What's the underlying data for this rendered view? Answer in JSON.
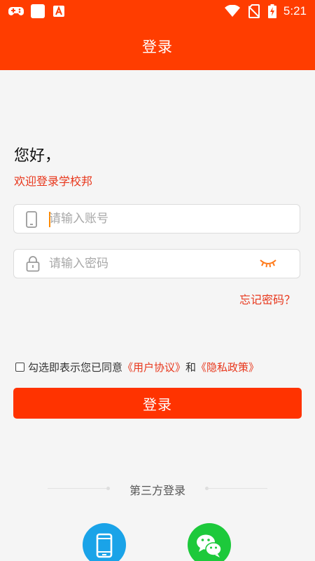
{
  "status_bar": {
    "time": "5:21",
    "left_icons": [
      "game-controller-icon",
      "app-square-icon",
      "a-app-icon"
    ],
    "right_icons": [
      "wifi-icon",
      "no-sim-icon",
      "battery-charging-icon"
    ]
  },
  "header": {
    "title": "登录"
  },
  "greeting": "您好，",
  "subtitle": "欢迎登录学校邦",
  "account_field": {
    "placeholder": "请输入账号",
    "icon": "phone-icon"
  },
  "password_field": {
    "placeholder": "请输入密码",
    "icon": "lock-icon",
    "toggle_icon": "eye-closed-icon"
  },
  "forgot_password": "忘记密码？",
  "agreement": {
    "prefix": "勾选即表示您已同意",
    "user_agreement": "《用户协议》",
    "conjunction": "和",
    "privacy_policy": "《隐私政策》"
  },
  "login_button": "登录",
  "third_party": {
    "label": "第三方登录",
    "options": [
      "phone-login-icon",
      "wechat-icon"
    ]
  },
  "colors": {
    "primary": "#ff3d00",
    "accent_text": "#e8361b",
    "button": "#ff3300",
    "phone_blue": "#1aa3e8",
    "wechat_green": "#1dc93b"
  }
}
